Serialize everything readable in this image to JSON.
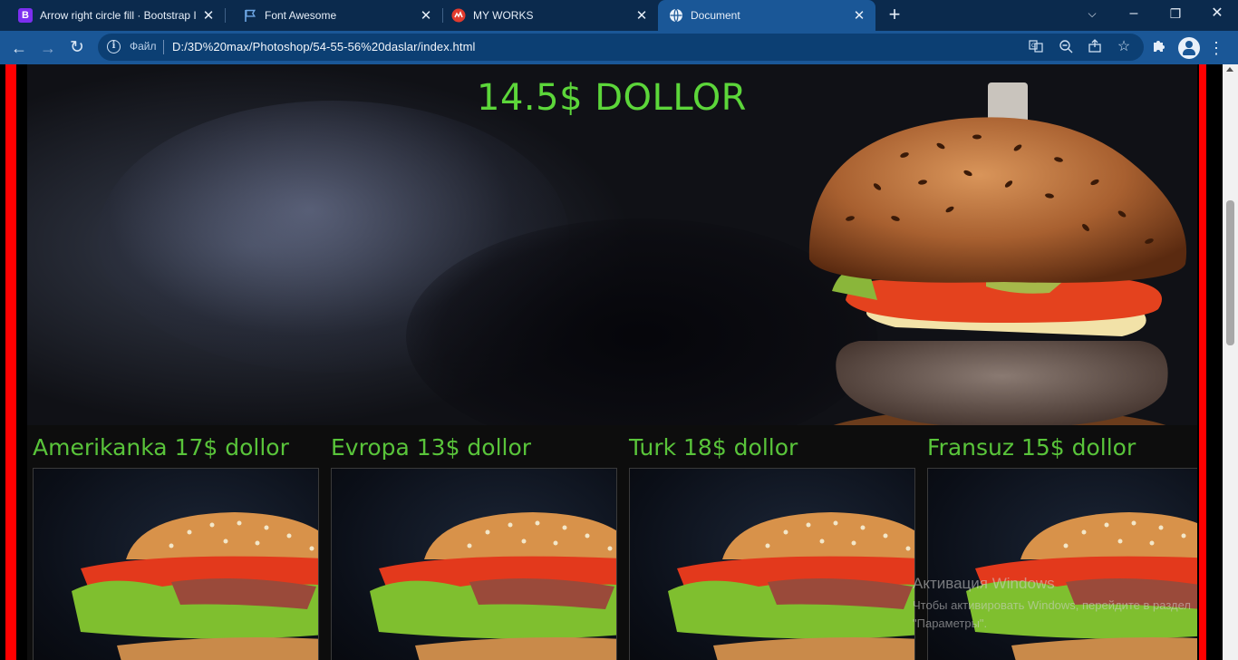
{
  "browser": {
    "tabs": [
      {
        "title": "Arrow right circle fill · Bootstrap I",
        "favicon": "B",
        "favicon_color": "#7c2ff0"
      },
      {
        "title": "Font Awesome",
        "favicon": "flag",
        "favicon_color": "#0b2a4d"
      },
      {
        "title": "MY WORKS",
        "favicon": "logo",
        "favicon_color": "#e23b2e"
      },
      {
        "title": "Document",
        "favicon": "globe",
        "favicon_color": "#1a5797"
      }
    ],
    "omnibox": {
      "scheme_label": "Файл",
      "url": "D:/3D%20max/Photoshop/54-55-56%20daslar/index.html"
    },
    "icons": {
      "back": "arrow-left-icon",
      "forward": "arrow-right-icon",
      "reload": "reload-icon",
      "translate": "translate-icon",
      "zoom": "zoom-icon",
      "share": "share-icon",
      "bookmark": "star-icon",
      "extensions": "puzzle-icon",
      "profile": "avatar-icon",
      "menu": "kebab-icon"
    }
  },
  "page": {
    "hero_price": "14.5$ DOLLOR",
    "cards": [
      {
        "title": "Amerikanka 17$ dollor"
      },
      {
        "title": "Evropa 13$ dollor"
      },
      {
        "title": "Turk 18$ dollor"
      },
      {
        "title": "Fransuz 15$ dollor"
      }
    ],
    "colors": {
      "price_green": "#5cd63a",
      "frame_red": "#ff0000"
    }
  },
  "os_overlay": {
    "activation_title": "Активация Windows",
    "activation_text": "Чтобы активировать Windows, перейдите в раздел \"Параметры\"."
  }
}
